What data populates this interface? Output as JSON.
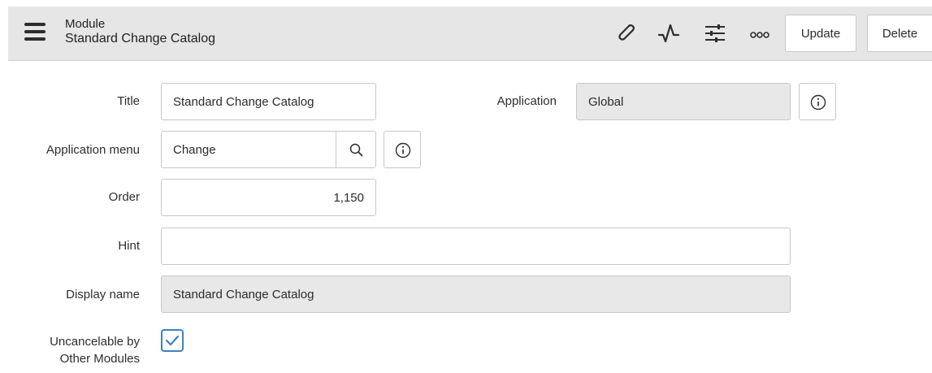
{
  "header": {
    "kind": "Module",
    "title": "Standard Change Catalog",
    "icons": [
      "menu-icon",
      "paperclip-icon",
      "activity-icon",
      "sliders-icon",
      "more-icon"
    ],
    "update_label": "Update",
    "delete_label": "Delete"
  },
  "form": {
    "title": {
      "label": "Title",
      "value": "Standard Change Catalog"
    },
    "application": {
      "label": "Application",
      "value": "Global"
    },
    "application_menu": {
      "label": "Application menu",
      "value": "Change"
    },
    "order": {
      "label": "Order",
      "value": "1,150"
    },
    "hint": {
      "label": "Hint",
      "value": ""
    },
    "display_name": {
      "label": "Display name",
      "value": "Standard Change Catalog"
    },
    "uncancelable": {
      "label_line1": "Uncancelable by",
      "label_line2": "Other Modules",
      "checked": true
    }
  },
  "colors": {
    "header_bg": "#e6e6e6",
    "readonly_bg": "#e8e8e8",
    "checkbox_accent": "#3b82c4"
  }
}
